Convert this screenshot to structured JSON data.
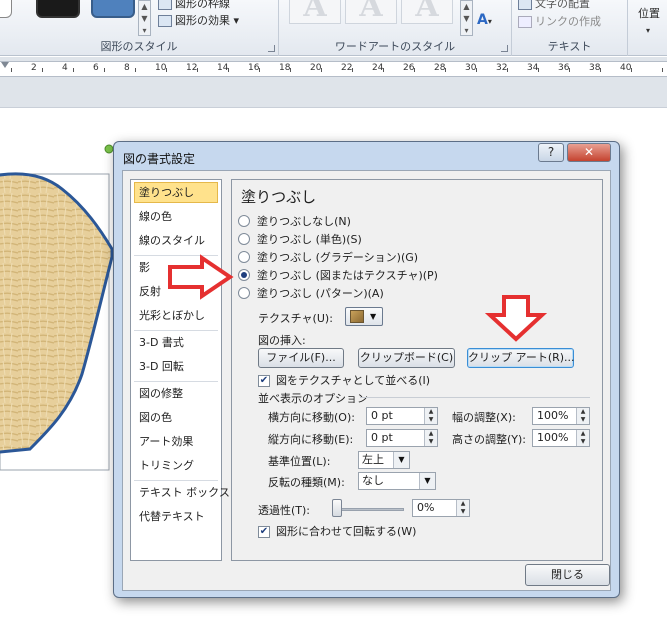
{
  "ribbon": {
    "shape_styles_label": "図形のスタイル",
    "shape_outline_label": "図形の枠線",
    "shape_effects_label": "図形の効果 ▾",
    "wordart_styles_label": "ワードアートのスタイル",
    "wordart_glyph": "A",
    "text_group_label": "テキスト",
    "text_align_label": "文字の配置",
    "create_link_label": "リンクの作成",
    "position_label": "位置"
  },
  "ruler": {
    "numbers": [
      "2",
      "4",
      "6",
      "8",
      "10",
      "12",
      "14",
      "16",
      "18",
      "20",
      "22",
      "24",
      "26",
      "28",
      "30",
      "32",
      "34",
      "36",
      "38",
      "40"
    ]
  },
  "dialog": {
    "title": "図の書式設定",
    "help_label": "?",
    "close_glyph": "✕",
    "close_label": "閉じる",
    "categories": [
      "塗りつぶし",
      "線の色",
      "線のスタイル",
      "影",
      "反射",
      "光彩とぼかし",
      "3-D 書式",
      "3-D 回転",
      "図の修整",
      "図の色",
      "アート効果",
      "トリミング",
      "テキスト ボックス",
      "代替テキスト"
    ],
    "selected_category": "塗りつぶし",
    "panel_title": "塗りつぶし",
    "fill_options": [
      {
        "label": "塗りつぶしなし(N)",
        "checked": false
      },
      {
        "label": "塗りつぶし (単色)(S)",
        "checked": false
      },
      {
        "label": "塗りつぶし (グラデーション)(G)",
        "checked": false
      },
      {
        "label": "塗りつぶし (図またはテクスチャ)(P)",
        "checked": true
      },
      {
        "label": "塗りつぶし (パターン)(A)",
        "checked": false
      }
    ],
    "texture_label": "テクスチャ(U):",
    "insert_label": "図の挿入:",
    "file_button": "ファイル(F)...",
    "clipboard_button": "クリップボード(C)",
    "clipart_button": "クリップ アート(R)...",
    "tile_checkbox": "図をテクスチャとして並べる(I)",
    "tile_checked": true,
    "tiling_options_label": "並べ表示のオプション",
    "offset_x_label": "横方向に移動(O):",
    "offset_x_value": "0 pt",
    "offset_y_label": "縦方向に移動(E):",
    "offset_y_value": "0 pt",
    "scale_x_label": "幅の調整(X):",
    "scale_x_value": "100%",
    "scale_y_label": "高さの調整(Y):",
    "scale_y_value": "100%",
    "alignment_label": "基準位置(L):",
    "alignment_value": "左上",
    "mirror_label": "反転の種類(M):",
    "mirror_value": "なし",
    "transparency_label": "透過性(T):",
    "transparency_value": "0%",
    "transparency_level": 0,
    "rotate_checkbox": "図形に合わせて回転する(W)",
    "rotate_checked": true
  },
  "colors": {
    "dialog_frame": "#c6d8ee",
    "selected_category": "#ffe28c",
    "arrow_outline": "#e53030",
    "texture_fill": "#e7cf9b",
    "heart_outline": "#2b5797"
  }
}
